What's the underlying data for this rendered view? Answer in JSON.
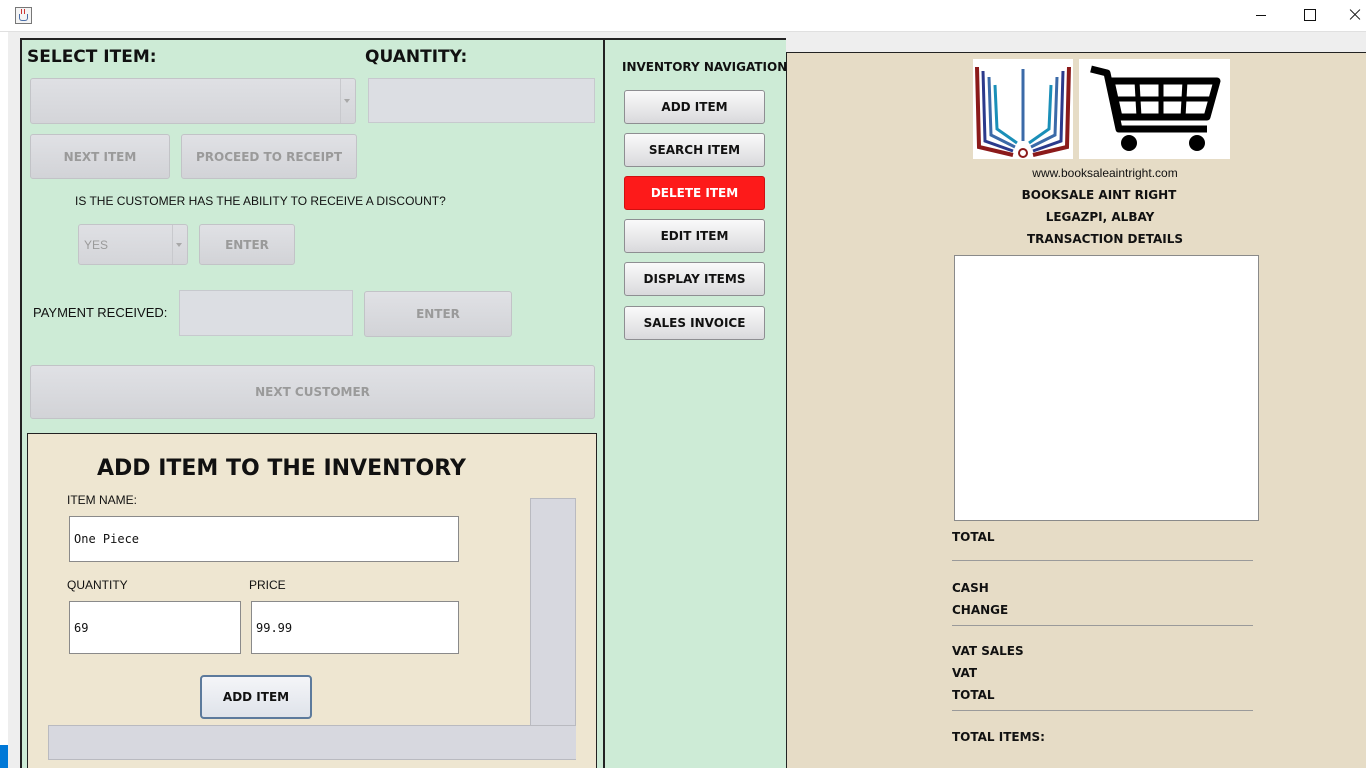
{
  "window": {
    "title": "",
    "controls": [
      "minimize",
      "maximize",
      "close"
    ]
  },
  "pos": {
    "select_item_label": "SELECT ITEM:",
    "quantity_label": "QUANTITY:",
    "select_item_value": "",
    "quantity_value": "",
    "next_item_label": "NEXT ITEM",
    "proceed_label": "PROCEED TO RECEIPT",
    "discount_question": "IS THE CUSTOMER HAS THE ABILITY TO RECEIVE A DISCOUNT?",
    "discount_selected": "YES",
    "discount_enter_label": "ENTER",
    "payment_label": "PAYMENT RECEIVED:",
    "payment_value": "",
    "payment_enter_label": "ENTER",
    "next_customer_label": "NEXT CUSTOMER"
  },
  "add_item": {
    "title": "ADD ITEM TO THE INVENTORY",
    "item_name_label": "ITEM NAME:",
    "item_name_value": "One Piece",
    "quantity_label": "QUANTITY",
    "quantity_value": "69",
    "price_label": "PRICE",
    "price_value": "99.99",
    "submit_label": "ADD ITEM"
  },
  "navigation": {
    "title": "INVENTORY NAVIGATION",
    "items": [
      {
        "label": "ADD ITEM"
      },
      {
        "label": "SEARCH ITEM"
      },
      {
        "label": "DELETE ITEM"
      },
      {
        "label": "EDIT ITEM"
      },
      {
        "label": "DISPLAY ITEMS"
      },
      {
        "label": "SALES INVOICE"
      }
    ]
  },
  "receipt": {
    "website": "www.booksaleaintright.com",
    "store_name": "BOOKSALE AINT RIGHT",
    "location": "LEGAZPI, ALBAY",
    "section_title": "TRANSACTION DETAILS",
    "total_label": "TOTAL",
    "cash_label": "CASH",
    "change_label": "CHANGE",
    "vat_sales_label": "VAT SALES",
    "vat_label": "VAT",
    "total2_label": "TOTAL",
    "total_items_label": "TOTAL ITEMS:"
  },
  "colors": {
    "pos_bg": "#cdebd6",
    "add_panel_bg": "#eee6d1",
    "receipt_bg": "#e6dcc6",
    "danger": "#fd1a1a"
  },
  "icons": [
    "java-app-icon",
    "books-logo-icon",
    "shopping-cart-icon"
  ]
}
